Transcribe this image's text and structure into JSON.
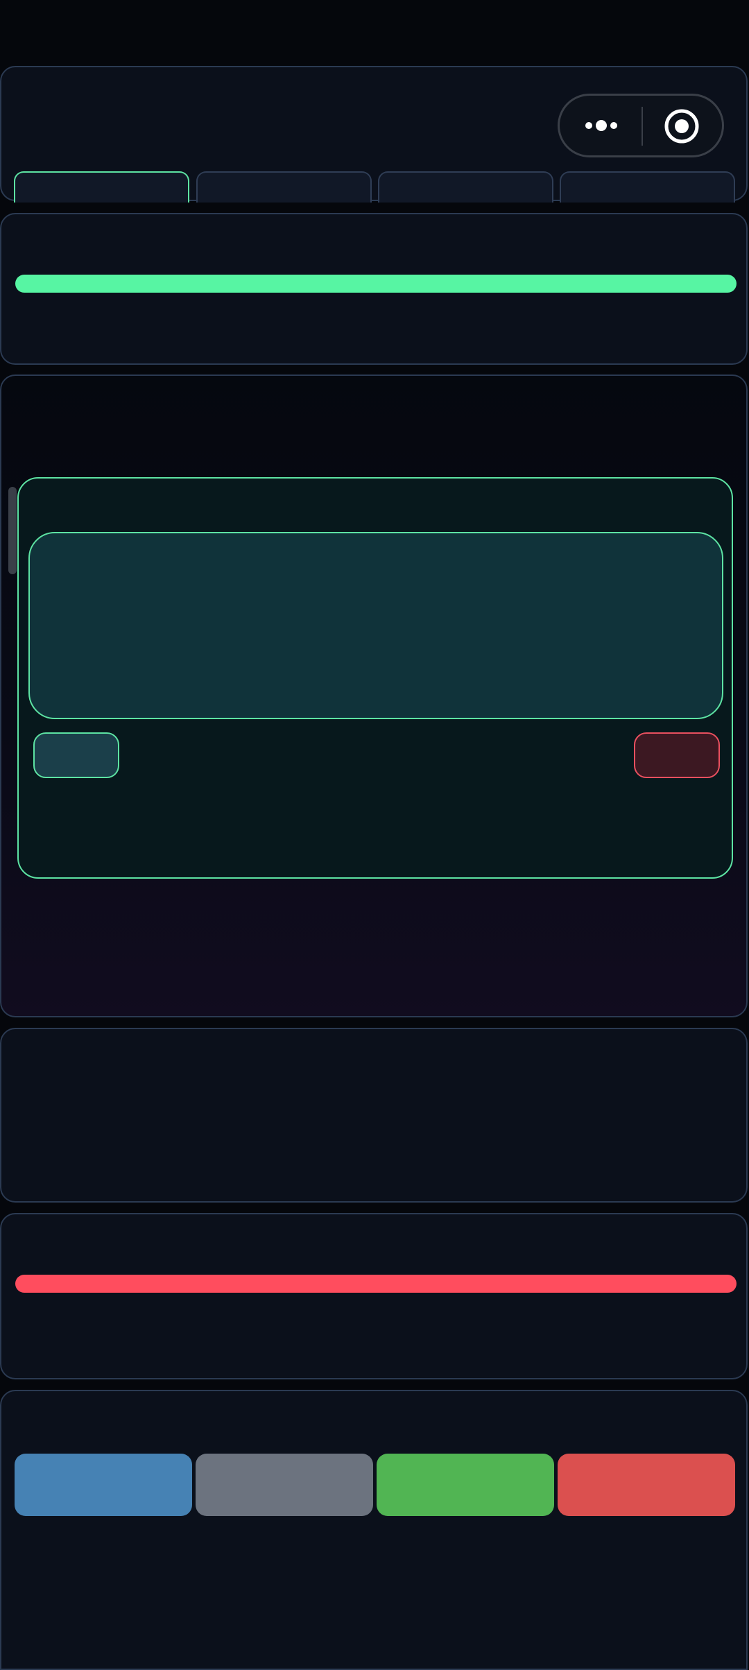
{
  "header": {
    "capsule": {
      "more_icon": "more-dots-icon",
      "target_icon": "target-icon"
    },
    "tabs": [
      {
        "label": "",
        "active": true
      },
      {
        "label": "",
        "active": false
      },
      {
        "label": "",
        "active": false
      },
      {
        "label": "",
        "active": false
      }
    ]
  },
  "progress": {
    "value_percent": 100,
    "color": "#57f5a3"
  },
  "dialog": {
    "editor_value": "",
    "confirm_label": "",
    "delete_label": ""
  },
  "alert": {
    "value_percent": 100,
    "color": "#ff4d5e"
  },
  "actions": [
    {
      "label": "",
      "color": "#4682b4"
    },
    {
      "label": "",
      "color": "#6c737f"
    },
    {
      "label": "",
      "color": "#51b553"
    },
    {
      "label": "",
      "color": "#db504f"
    }
  ],
  "colors": {
    "accent": "#5de3a3",
    "danger": "#e9505f",
    "background": "#05070c",
    "panel": "#0b101b"
  }
}
